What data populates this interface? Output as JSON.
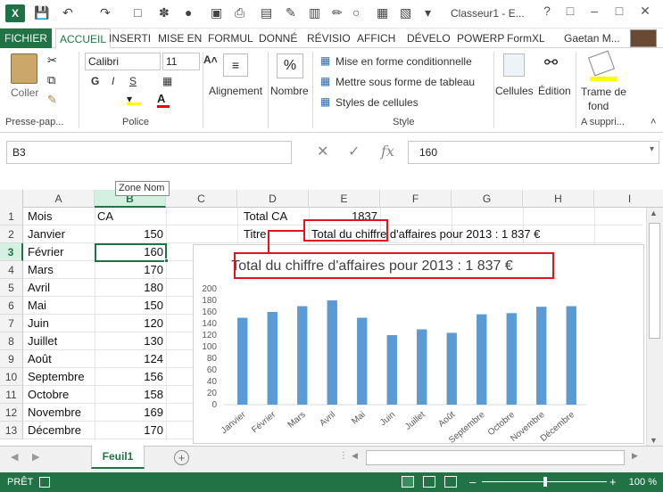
{
  "titlebar": {
    "window_title": "Classeur1 - E...",
    "help": "?"
  },
  "tabs": [
    "FICHIER",
    "ACCUEIL",
    "INSERTI",
    "MISE EN",
    "FORMUL",
    "DONNÉ",
    "RÉVISIO",
    "AFFICH",
    "DÉVELO",
    "POWERP",
    "FormXL"
  ],
  "user": "Gaetan M...",
  "ribbon": {
    "paste_label": "Coller",
    "clipboard_group": "Presse-pap...",
    "font_name": "Calibri",
    "font_size": "11",
    "bold": "G",
    "italic": "I",
    "underline": "S",
    "font_group": "Police",
    "alignment": "Alignement",
    "number": "Nombre",
    "number_symbol": "%",
    "cond_format": "Mise en forme conditionnelle",
    "table_format": "Mettre sous forme de tableau",
    "cell_styles": "Styles de cellules",
    "style_group": "Style",
    "cells": "Cellules",
    "editing": "Édition",
    "fill_label_1": "Trame de",
    "fill_label_2": "fond",
    "addon_group": "A suppri..."
  },
  "formula_bar": {
    "name_box": "B3",
    "fx": "fx",
    "value": "160"
  },
  "tooltip": "Zone Nom",
  "columns": [
    "A",
    "B",
    "C",
    "D",
    "E",
    "F",
    "G",
    "H",
    "I"
  ],
  "rows": [
    "1",
    "2",
    "3",
    "4",
    "5",
    "6",
    "7",
    "8",
    "9",
    "10",
    "11",
    "12",
    "13"
  ],
  "cells": {
    "A": [
      "Mois",
      "Janvier",
      "Février",
      "Mars",
      "Avril",
      "Mai",
      "Juin",
      "Juillet",
      "Août",
      "Septembre",
      "Octobre",
      "Novembre",
      "Décembre"
    ],
    "B": [
      "CA",
      "150",
      "160",
      "170",
      "180",
      "150",
      "120",
      "130",
      "124",
      "156",
      "158",
      "169",
      "170"
    ],
    "D1": "Total CA",
    "E1": "1837",
    "D2": "Titre",
    "E2": "Total du chiffre d'affaires pour 2013 : 1 837 €"
  },
  "chart_data": {
    "type": "bar",
    "title": "Total du chiffre d'affaires pour 2013 : 1 837 €",
    "categories": [
      "Janvier",
      "Février",
      "Mars",
      "Avril",
      "Mai",
      "Juin",
      "Juillet",
      "Août",
      "Septembre",
      "Octobre",
      "Novembre",
      "Décembre"
    ],
    "values": [
      150,
      160,
      170,
      180,
      150,
      120,
      130,
      124,
      156,
      158,
      169,
      170
    ],
    "ylim": [
      0,
      200
    ],
    "yticks": [
      "0",
      "20",
      "40",
      "60",
      "80",
      "100",
      "120",
      "140",
      "160",
      "180",
      "200"
    ],
    "grid": false,
    "bar_color": "#5b9bd5"
  },
  "sheet_tab": "Feuil1",
  "status": {
    "mode": "PRÊT",
    "zoom": "100 %"
  },
  "colors": {
    "excel_green": "#217346",
    "annotation_red": "#e0141e"
  }
}
